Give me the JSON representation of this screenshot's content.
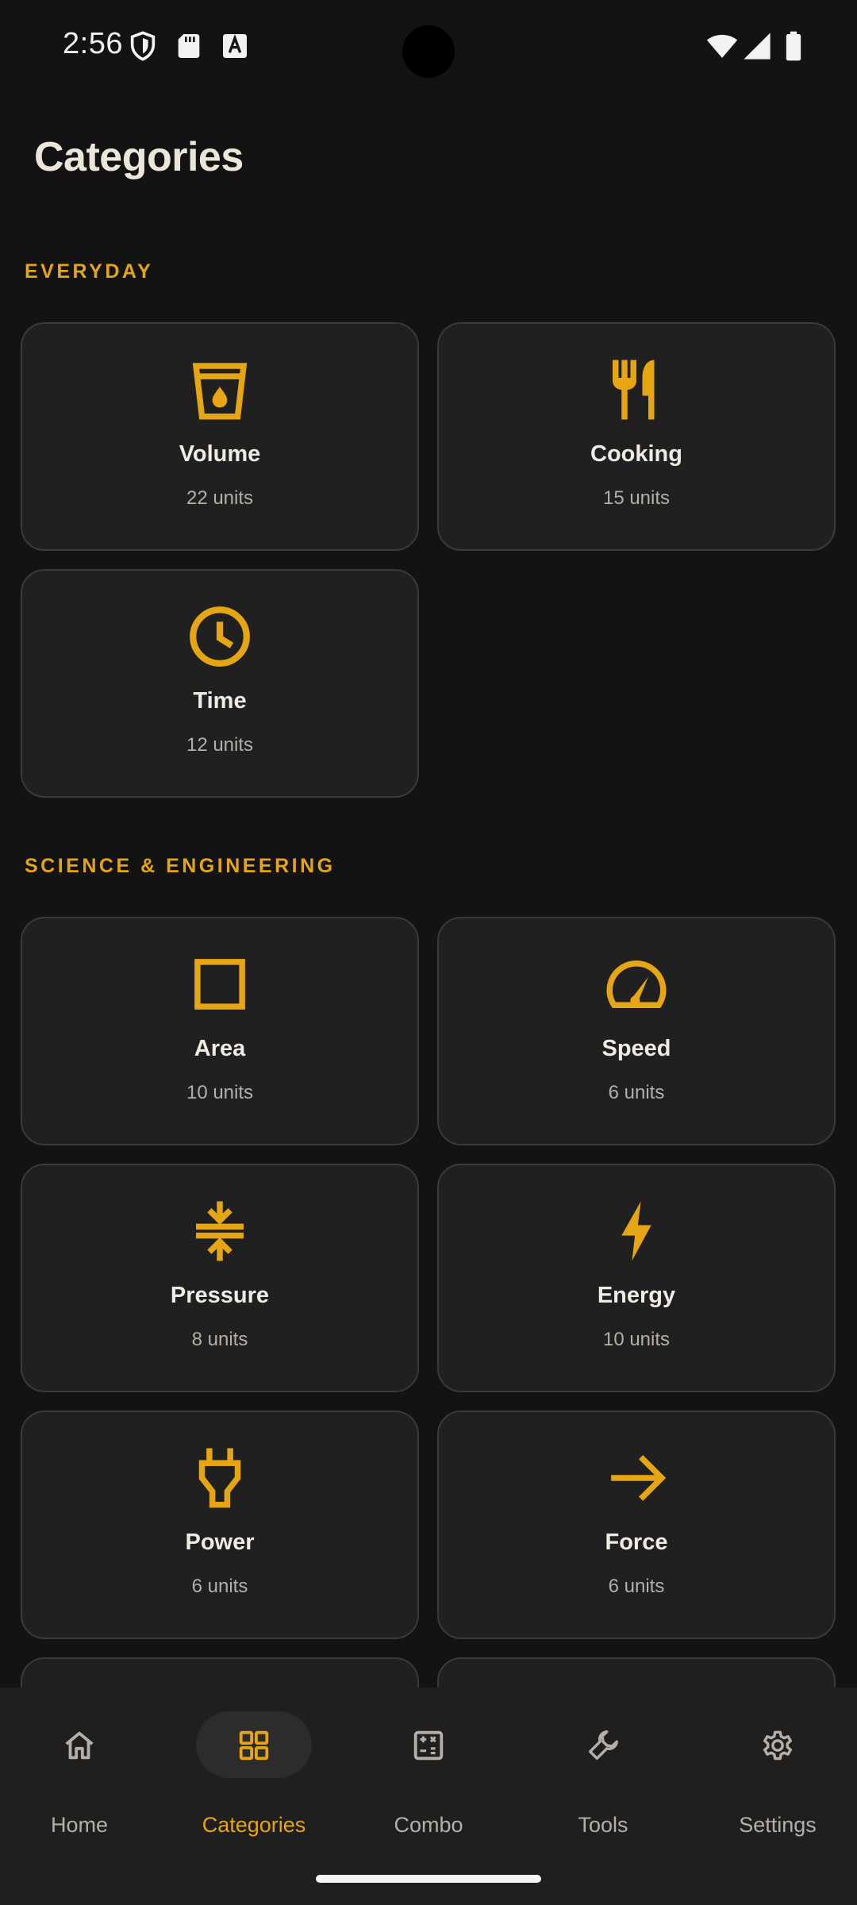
{
  "status_bar": {
    "time": "2:56",
    "icons": [
      "shield-icon",
      "sd-card-icon",
      "keyboard-a-icon",
      "wifi-icon",
      "cell-signal-icon",
      "battery-icon"
    ]
  },
  "header": {
    "title": "Categories"
  },
  "sections": [
    {
      "title": "EVERYDAY",
      "cards": [
        {
          "name": "Volume",
          "units": "22 units",
          "icon": "cup-drop-icon"
        },
        {
          "name": "Cooking",
          "units": "15 units",
          "icon": "fork-knife-icon"
        },
        {
          "name": "Time",
          "units": "12 units",
          "icon": "clock-icon"
        }
      ]
    },
    {
      "title": "SCIENCE & ENGINEERING",
      "cards": [
        {
          "name": "Area",
          "units": "10 units",
          "icon": "square-icon"
        },
        {
          "name": "Speed",
          "units": "6 units",
          "icon": "speedometer-icon"
        },
        {
          "name": "Pressure",
          "units": "8 units",
          "icon": "compress-icon"
        },
        {
          "name": "Energy",
          "units": "10 units",
          "icon": "bolt-icon"
        },
        {
          "name": "Power",
          "units": "6 units",
          "icon": "plug-icon"
        },
        {
          "name": "Force",
          "units": "6 units",
          "icon": "arrow-right-icon"
        }
      ]
    }
  ],
  "bottom_nav": {
    "items": [
      {
        "label": "Home",
        "icon": "home-icon",
        "active": false
      },
      {
        "label": "Categories",
        "icon": "grid-icon",
        "active": true
      },
      {
        "label": "Combo",
        "icon": "calculator-icon",
        "active": false
      },
      {
        "label": "Tools",
        "icon": "wrench-icon",
        "active": false
      },
      {
        "label": "Settings",
        "icon": "gear-icon",
        "active": false
      }
    ]
  },
  "colors": {
    "background": "#131313",
    "card": "#202020",
    "card_border": "#3A3A3A",
    "accent": "#E6A512",
    "text_primary": "#F0EBE3",
    "text_secondary": "#B5AFA7",
    "nav_background": "#1F1F1F"
  }
}
